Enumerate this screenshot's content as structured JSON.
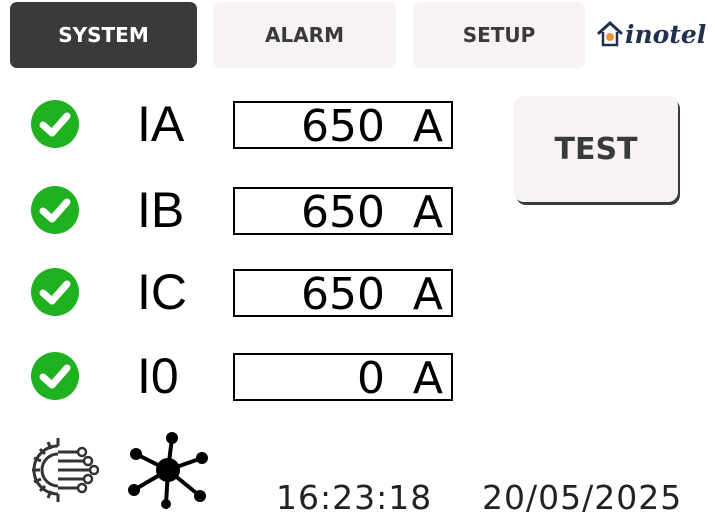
{
  "tabs": {
    "system": "SYSTEM",
    "alarm": "ALARM",
    "setup": "SETUP"
  },
  "logo_text": "inotel",
  "currents": [
    {
      "label": "IA",
      "value": "650",
      "unit": "A",
      "status": "ok"
    },
    {
      "label": "IB",
      "value": "650",
      "unit": "A",
      "status": "ok"
    },
    {
      "label": "IC",
      "value": "650",
      "unit": "A",
      "status": "ok"
    },
    {
      "label": "I0",
      "value": "0",
      "unit": "A",
      "status": "ok"
    }
  ],
  "test_label": "TEST",
  "footer": {
    "time": "16:23:18",
    "date": "20/05/2025"
  },
  "icons": {
    "status": "check-circle-icon",
    "settings": "gear-circuit-icon",
    "network": "network-hub-icon",
    "logo": "inotel-logo"
  },
  "colors": {
    "ok_green": "#1fb11f",
    "active_tab": "#3a3a3a",
    "inactive_tab": "#f6f2f6"
  }
}
